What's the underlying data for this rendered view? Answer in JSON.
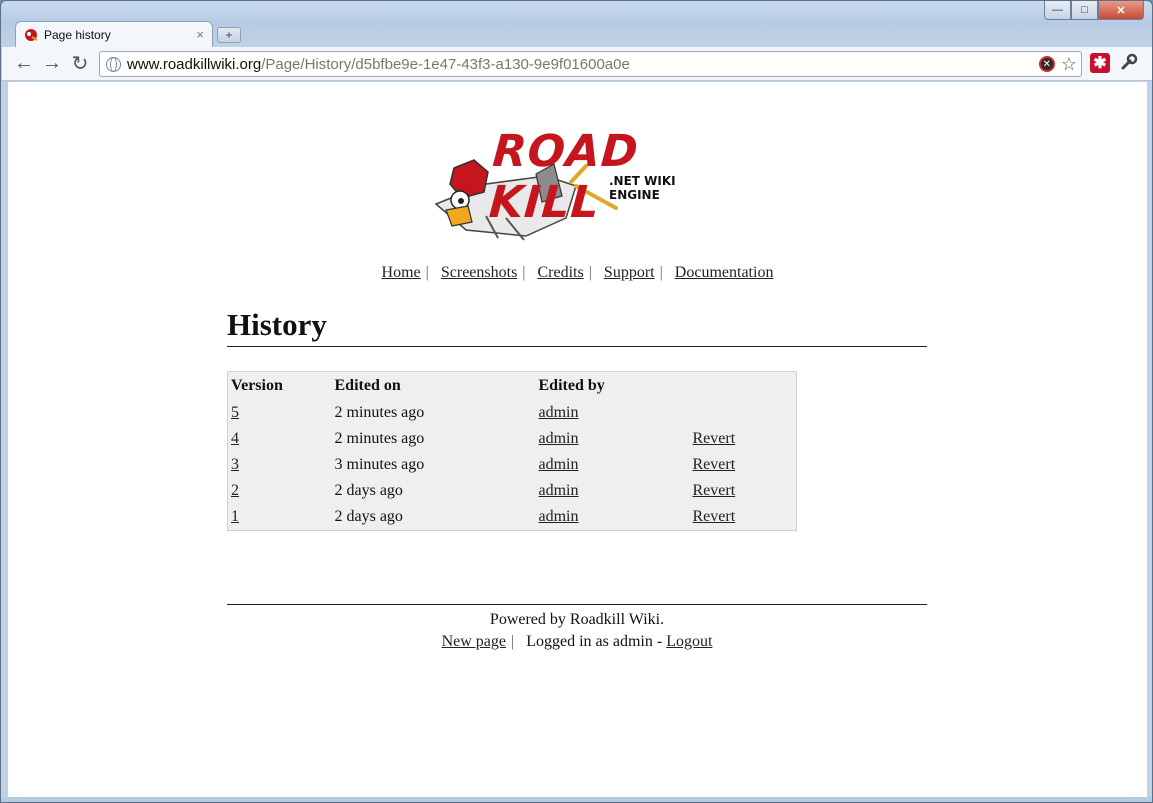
{
  "browser": {
    "tab_title": "Page history",
    "tab_close": "×",
    "new_tab": "+",
    "url_host": "www.roadkillwiki.org",
    "url_path": "/Page/History/d5bfbe9e-1e47-43f3-a130-9e9f01600a0e",
    "window_min": "—",
    "window_max": "□",
    "window_close": "✕",
    "back_glyph": "←",
    "forward_glyph": "→",
    "reload_glyph": "↻",
    "extension_glyph": "✱",
    "wrench_glyph": "🔧",
    "star_glyph": "☆"
  },
  "logo": {
    "title": "ROAD KILL",
    "subtitle": ".NET WIKI ENGINE"
  },
  "nav": {
    "items": [
      {
        "label": "Home"
      },
      {
        "label": "Screenshots"
      },
      {
        "label": "Credits"
      },
      {
        "label": "Support"
      },
      {
        "label": "Documentation"
      }
    ],
    "separator": "|"
  },
  "page": {
    "title": "History"
  },
  "history": {
    "headers": [
      "Version",
      "Edited on",
      "Edited by",
      ""
    ],
    "rows": [
      {
        "version": "5",
        "edited_on": "2 minutes ago",
        "edited_by": "admin",
        "action": ""
      },
      {
        "version": "4",
        "edited_on": "2 minutes ago",
        "edited_by": "admin",
        "action": "Revert"
      },
      {
        "version": "3",
        "edited_on": "3 minutes ago",
        "edited_by": "admin",
        "action": "Revert"
      },
      {
        "version": "2",
        "edited_on": "2 days ago",
        "edited_by": "admin",
        "action": "Revert"
      },
      {
        "version": "1",
        "edited_on": "2 days ago",
        "edited_by": "admin",
        "action": "Revert"
      }
    ]
  },
  "footer": {
    "powered_by": "Powered by Roadkill Wiki.",
    "new_page": "New page",
    "separator": "|",
    "logged_in_text": "Logged in as admin -",
    "logout": "Logout"
  },
  "colors": {
    "brand_red": "#c4161c",
    "table_bg": "#efefef"
  }
}
